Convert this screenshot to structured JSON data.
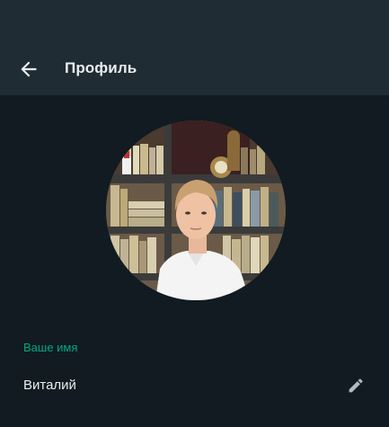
{
  "header": {
    "title": "Профиль",
    "back_icon": "arrow-left-icon"
  },
  "profile": {
    "avatar_alt": "profile-photo",
    "name_label": "Ваше имя",
    "name_value": "Виталий",
    "edit_icon": "pencil-icon"
  },
  "colors": {
    "header_bg": "#202c33",
    "page_bg": "#111b21",
    "accent": "#00a884",
    "text_primary": "#e9edef",
    "icon": "#aebac1"
  }
}
